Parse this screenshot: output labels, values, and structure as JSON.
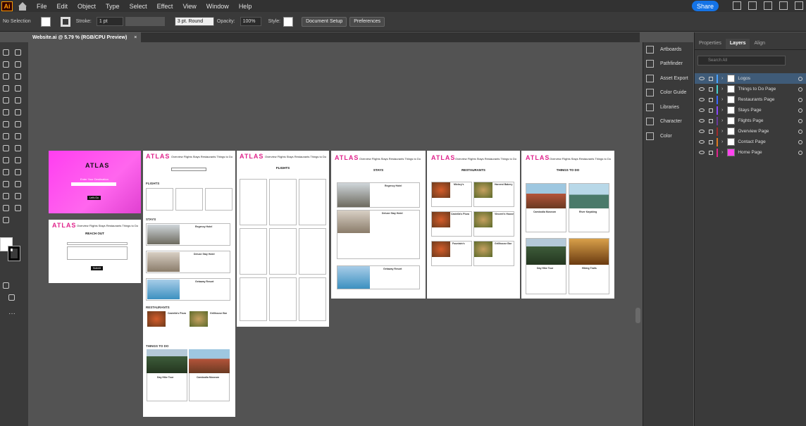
{
  "menubar": {
    "logo": "Ai",
    "items": [
      "File",
      "Edit",
      "Object",
      "Type",
      "Select",
      "Effect",
      "View",
      "Window",
      "Help"
    ],
    "share": "Share"
  },
  "control": {
    "selection": "No Selection",
    "stroke_label": "Stroke:",
    "stroke_value": "1 pt",
    "brush": "3 pt. Round",
    "opacity_label": "Opacity:",
    "opacity_value": "100%",
    "style_label": "Style:",
    "doc_setup": "Document Setup",
    "preferences": "Preferences"
  },
  "document": {
    "tab": "Website.ai @ 5.79 % (RGB/CPU Preview)",
    "close": "×"
  },
  "dock": {
    "items": [
      "Artboards",
      "Pathfinder",
      "Asset Export",
      "Color Guide",
      "Libraries",
      "Character",
      "Color"
    ]
  },
  "panel": {
    "tabs": [
      "Properties",
      "Layers",
      "Align"
    ],
    "search_placeholder": "Search All",
    "layers": [
      {
        "name": "Logos",
        "color": "#4aa3ff",
        "selected": true
      },
      {
        "name": "Things to Do Page",
        "color": "#4ad0d0"
      },
      {
        "name": "Restaurants Page",
        "color": "#3a6aff"
      },
      {
        "name": "Stays Page",
        "color": "#8a4aff"
      },
      {
        "name": "Flights Page",
        "color": "#6a3a9a"
      },
      {
        "name": "Overview Page",
        "color": "#a02a2a"
      },
      {
        "name": "Contact Page",
        "color": "#e07a20"
      },
      {
        "name": "Home Page",
        "color": "#e0248c"
      }
    ]
  },
  "artboards": {
    "brand": "ATLAS",
    "nav": "Overview   Flights   Stays   Restaurants   Things to Do",
    "home": {
      "title": "ATLAS",
      "subtitle": "Enter Your Destination",
      "button": "Let's Go"
    },
    "contact": {
      "title": "REACH OUT",
      "button": "Submit"
    },
    "overview": {
      "flights": "FLIGHTS",
      "stays": "STAYS",
      "restaurants": "RESTAURANTS",
      "things": "THINGS TO DO",
      "hotels": [
        "Regency Hotel",
        "Deluxe Stay Hotel",
        "Getaway Resort"
      ],
      "rest": [
        "Castella's Pizza",
        "Grillhouse Bar"
      ],
      "todo": [
        "Day Hike Tour",
        "Cambodia Museum"
      ]
    },
    "flights_page": {
      "title": "FLIGHTS"
    },
    "stays_page": {
      "title": "STAYS",
      "hotels": [
        "Regency Hotel",
        "Deluxe Stay Hotel",
        "Getaway Resort"
      ]
    },
    "rest_page": {
      "title": "RESTAURANTS",
      "items": [
        "Mickey's",
        "Harvest Bakery",
        "Castella's Pizza",
        "Vincent's House",
        "Fountain's",
        "Grillhouse Bar"
      ]
    },
    "todo_page": {
      "title": "THINGS TO DO",
      "items": [
        "Cambodia Museum",
        "River Kayaking",
        "Day Hike Tour",
        "Hiking Trails"
      ]
    }
  }
}
